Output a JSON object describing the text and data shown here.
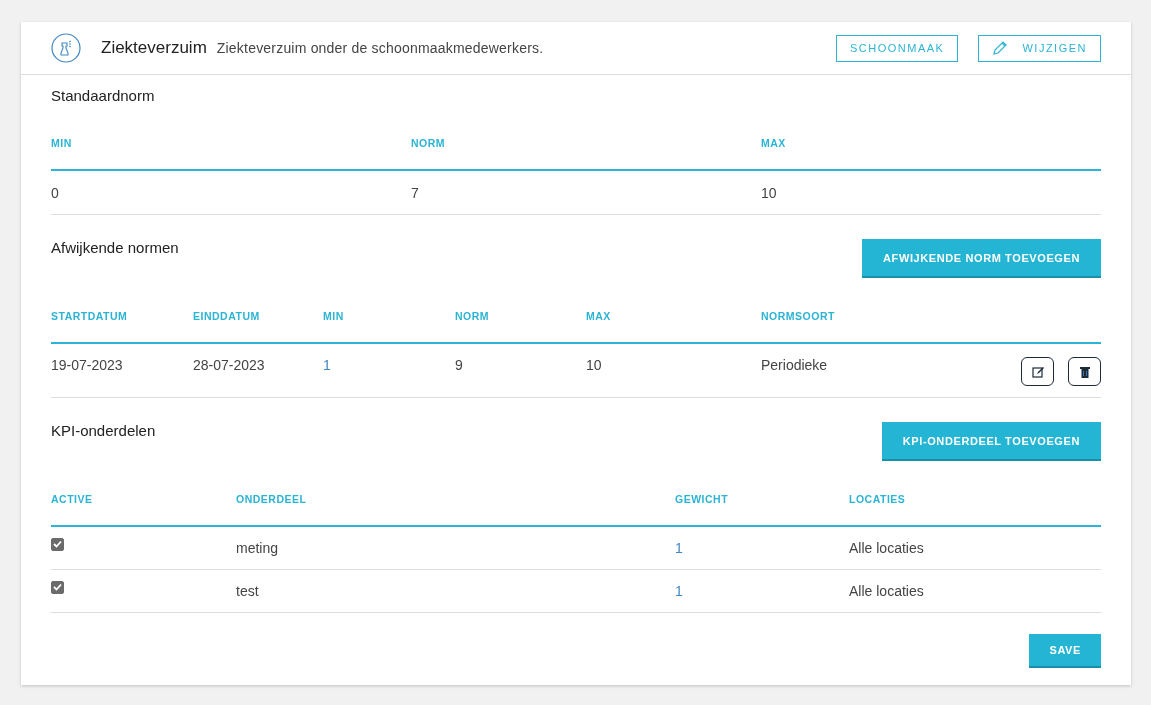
{
  "header": {
    "title": "Ziekteverzuim",
    "description": "Ziekteverzuim onder de schoonmaakmedewerkers.",
    "buttons": [
      {
        "label": "SCHOONMAAK",
        "kind": "plain"
      },
      {
        "label": "WIJZIGEN",
        "kind": "edit"
      }
    ]
  },
  "standard": {
    "title": "Standaardnorm",
    "columns": [
      "MIN",
      "NORM",
      "MAX"
    ],
    "rows": [
      [
        "0",
        "7",
        "10"
      ]
    ]
  },
  "deviating": {
    "title": "Afwijkende normen",
    "button": "AFWIJKENDE NORM TOEVOEGEN",
    "columns": [
      "STARTDATUM",
      "EINDDATUM",
      "MIN",
      "NORM",
      "MAX",
      "NORMSOORT"
    ],
    "rows": [
      {
        "cells": [
          {
            "text": "19-07-2023",
            "kind": "plain"
          },
          {
            "text": "28-07-2023",
            "kind": "plain"
          },
          {
            "text": "1",
            "kind": "link"
          },
          {
            "text": "9",
            "kind": "plain"
          },
          {
            "text": "10",
            "kind": "plain"
          },
          {
            "text": "Periodieke",
            "kind": "plain"
          }
        ]
      }
    ]
  },
  "kpi": {
    "title": "KPI-onderdelen",
    "button": "KPI-ONDERDEEL TOEVOEGEN",
    "columns": [
      "ACTIVE",
      "ONDERDEEL",
      "GEWICHT",
      "LOCATIES"
    ],
    "rows": [
      {
        "checked": true,
        "part": "meting",
        "weight": "1",
        "locations": "Alle locaties"
      },
      {
        "checked": true,
        "part": "test",
        "weight": "1",
        "locations": "Alle locaties"
      }
    ]
  },
  "save_button": "SAVE"
}
